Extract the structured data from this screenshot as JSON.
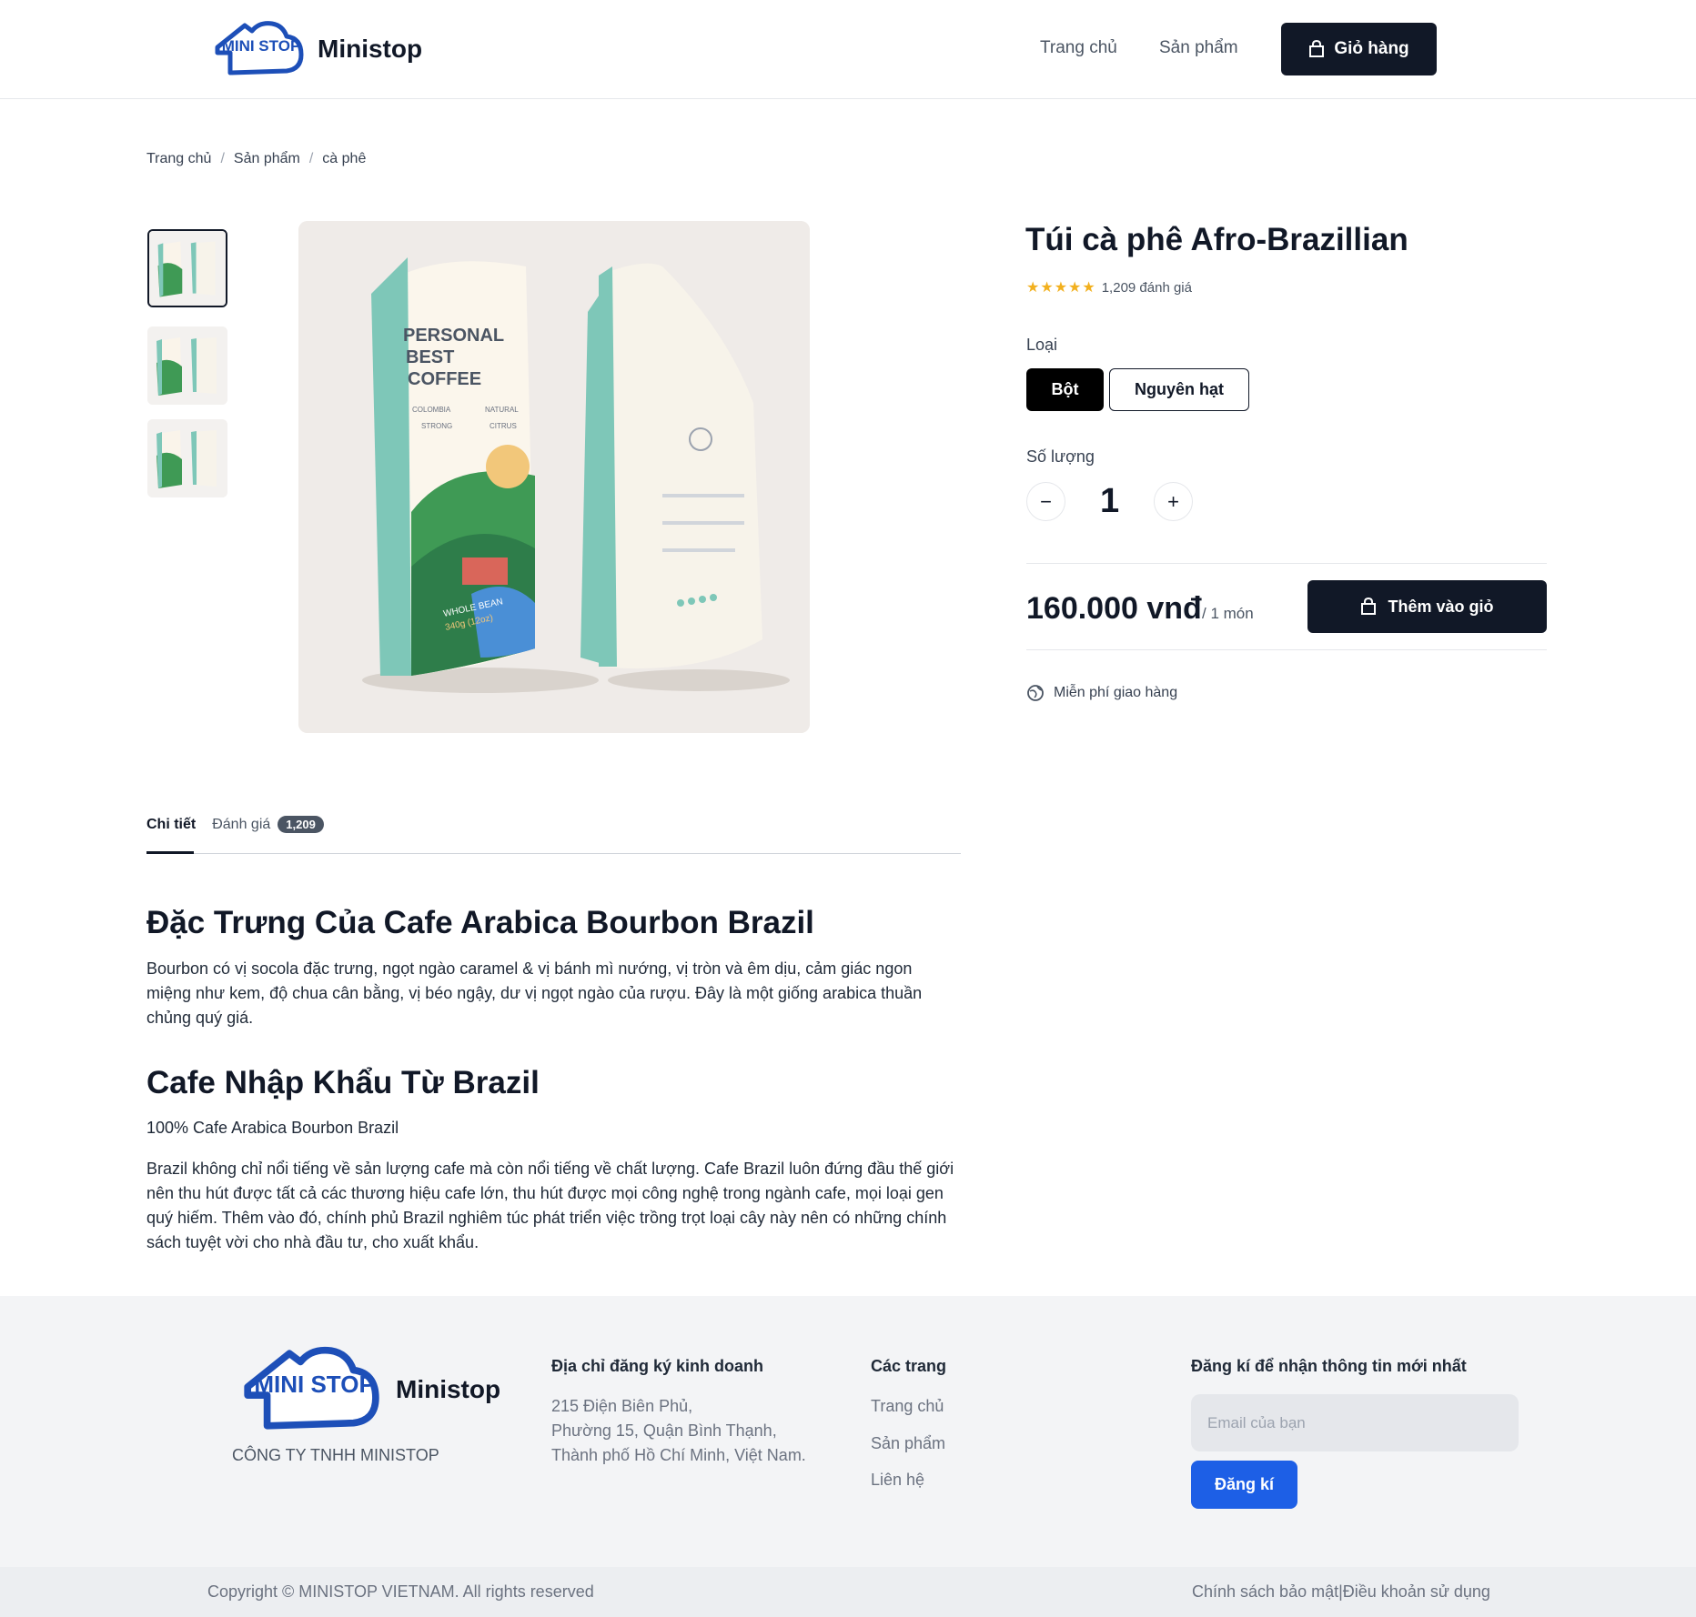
{
  "header": {
    "logo_mark_text": "MINI STOP",
    "brand": "Ministop",
    "nav": [
      "Trang chủ",
      "Sản phẩm"
    ],
    "cart_label": "Giỏ hàng"
  },
  "breadcrumb": [
    "Trang chủ",
    "Sản phẩm",
    "cà phê"
  ],
  "product": {
    "title": "Túi cà phê Afro-Brazillian",
    "stars": "★★★★★",
    "rating_count": 5,
    "reviews_text": "1,209 đánh giá",
    "type_label": "Loại",
    "variants": [
      "Bột",
      "Nguyên hạt"
    ],
    "selected_variant": "Bột",
    "quantity_label": "Số lượng",
    "quantity": "1",
    "price": "160.000 vnđ",
    "price_unit": "/ 1 món",
    "add_to_cart": "Thêm vào giỏ",
    "shipping": "Miễn phí giao hàng",
    "package_art_text": [
      "PERSONAL",
      "BEST",
      "COFFEE",
      "COLOMBIA",
      "NATURAL",
      "STRONG",
      "CITRUS",
      "WHOLE BEAN",
      "340g (12oz)"
    ]
  },
  "tabs": {
    "details": "Chi tiết",
    "reviews": "Đánh giá",
    "reviews_badge": "1,209"
  },
  "content": {
    "heading1": "Đặc Trưng Của Cafe Arabica Bourbon Brazil",
    "para1": "Bourbon có vị socola đặc trưng, ngọt ngào caramel & vị bánh mì nướng, vị tròn và êm dịu, cảm giác ngon miệng như kem, độ chua cân bằng, vị béo ngậy, dư vị ngọt ngào của rượu. Đây là một giống arabica thuần chủng quý giá.",
    "heading2": "Cafe Nhập Khẩu Từ Brazil",
    "para2": "100% Cafe Arabica Bourbon Brazil",
    "para3": "Brazil không chỉ nổi tiếng về sản lượng cafe mà còn nổi tiếng về chất lượng. Cafe Brazil luôn đứng đầu thế giới nên thu hút được tất cả các thương hiệu cafe lớn, thu hút được mọi công nghệ trong ngành cafe, mọi loại gen quý hiếm. Thêm vào đó, chính phủ Brazil nghiêm túc phát triển việc trồng trọt loại cây này nên có những chính sách tuyệt vời cho nhà đầu tư, cho xuất khẩu."
  },
  "footer": {
    "brand": "Ministop",
    "company": "CÔNG TY TNHH MINISTOP",
    "address_heading": "Địa chỉ đăng ký kinh doanh",
    "address_lines": [
      "215 Điện Biên Phủ,",
      "Phường 15, Quận Bình Thạnh,",
      "Thành phố Hồ Chí Minh, Việt Nam."
    ],
    "pages_heading": "Các trang",
    "pages": [
      "Trang chủ",
      "Sản phẩm",
      "Liên hệ"
    ],
    "newsletter_heading": "Đăng kí để nhận thông tin mới nhất",
    "email_placeholder": "Email của bạn",
    "subscribe": "Đăng kí",
    "copyright": "Copyright © MINISTOP VIETNAM. All rights reserved",
    "policy": "Chính sách bảo mật|Điều khoản sử dụng"
  },
  "colors": {
    "dark": "#111827",
    "star": "#f2b01e",
    "brand_blue": "#1d4fb8",
    "subscribe_blue": "#1d5fe6"
  }
}
